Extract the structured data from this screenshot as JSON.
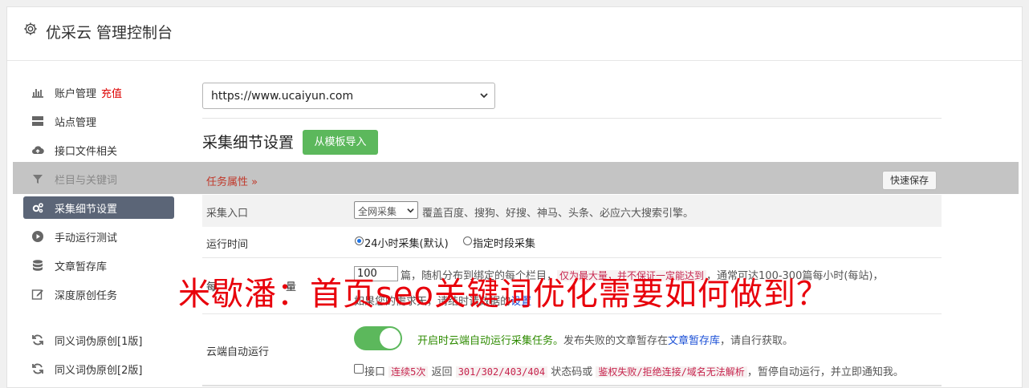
{
  "header": {
    "title": "优采云 管理控制台",
    "icon": "gear-icon"
  },
  "sidebar": {
    "items": [
      {
        "label": "账户管理",
        "extra": "充值",
        "icon": "bar-chart-icon"
      },
      {
        "label": "站点管理",
        "icon": "server-icon"
      },
      {
        "label": "接口文件相关",
        "icon": "cloud-upload-icon"
      },
      {
        "label": "栏目与关键词",
        "icon": "filter-icon"
      },
      {
        "label": "采集细节设置",
        "icon": "gears-icon"
      },
      {
        "label": "手动运行测试",
        "icon": "play-circle-icon"
      },
      {
        "label": "文章暂存库",
        "icon": "database-icon"
      },
      {
        "label": "深度原创任务",
        "icon": "edit-icon"
      },
      {
        "label": "同义词伪原创[1版]",
        "icon": "refresh-icon"
      },
      {
        "label": "同义词伪原创[2版]",
        "icon": "refresh-icon"
      }
    ]
  },
  "main": {
    "site_select": "https://www.ucaiyun.com",
    "section_title": "采集细节设置",
    "import_button": "从模板导入",
    "task_attr": "任务属性",
    "quick_save": "快速保存",
    "rows": {
      "entry": {
        "label": "采集入口",
        "select_value": "全网采集",
        "desc": "覆盖百度、搜狗、好搜、神马、头条、必应六大搜索引擎。"
      },
      "runtime": {
        "label": "运行时间",
        "option1": "24小时采集(默认)",
        "option2": "指定时段采集"
      },
      "daily": {
        "label_a": "每",
        "label_b": "量",
        "input_value": "100",
        "text1": "篇，随机分布到绑定的每个栏目，",
        "code1": "仅为最大量，并不保证一定能达到",
        "text2": "，通常可达100-300篇每小时(每站)，",
        "line2_a": "如果您的",
        "line2_b": "需求",
        "line2_c": "天，请",
        "line2_d": "结",
        "line2_e": "时",
        "line2_f": "请",
        "line2_g": "数",
        "line2_h": "据",
        "line2_i": "的",
        "line2_j": "设置"
      },
      "cloud": {
        "label": "云端自动运行",
        "on_text": "开启时云端自动运行采集任务。",
        "text_a": "发布失败的文章暂存在",
        "link": "文章暂存库",
        "text_b": "，请自行获取。",
        "chk_text": "接口",
        "code_a": "连续5次",
        "text_c": "返回",
        "code_b": "301/302/403/404",
        "text_d": "状态码或",
        "code_c": "鉴权失败/拒绝连接/域名无法解析",
        "text_e": "，暂停自动运行，并立即通知我。"
      }
    }
  },
  "watermark": "米歇潘：首页seo关键词优化需要如何做到？",
  "colors": {
    "accent_green": "#5cb85c",
    "active_nav": "#5b6577",
    "watermark_red": "#e8000b"
  }
}
